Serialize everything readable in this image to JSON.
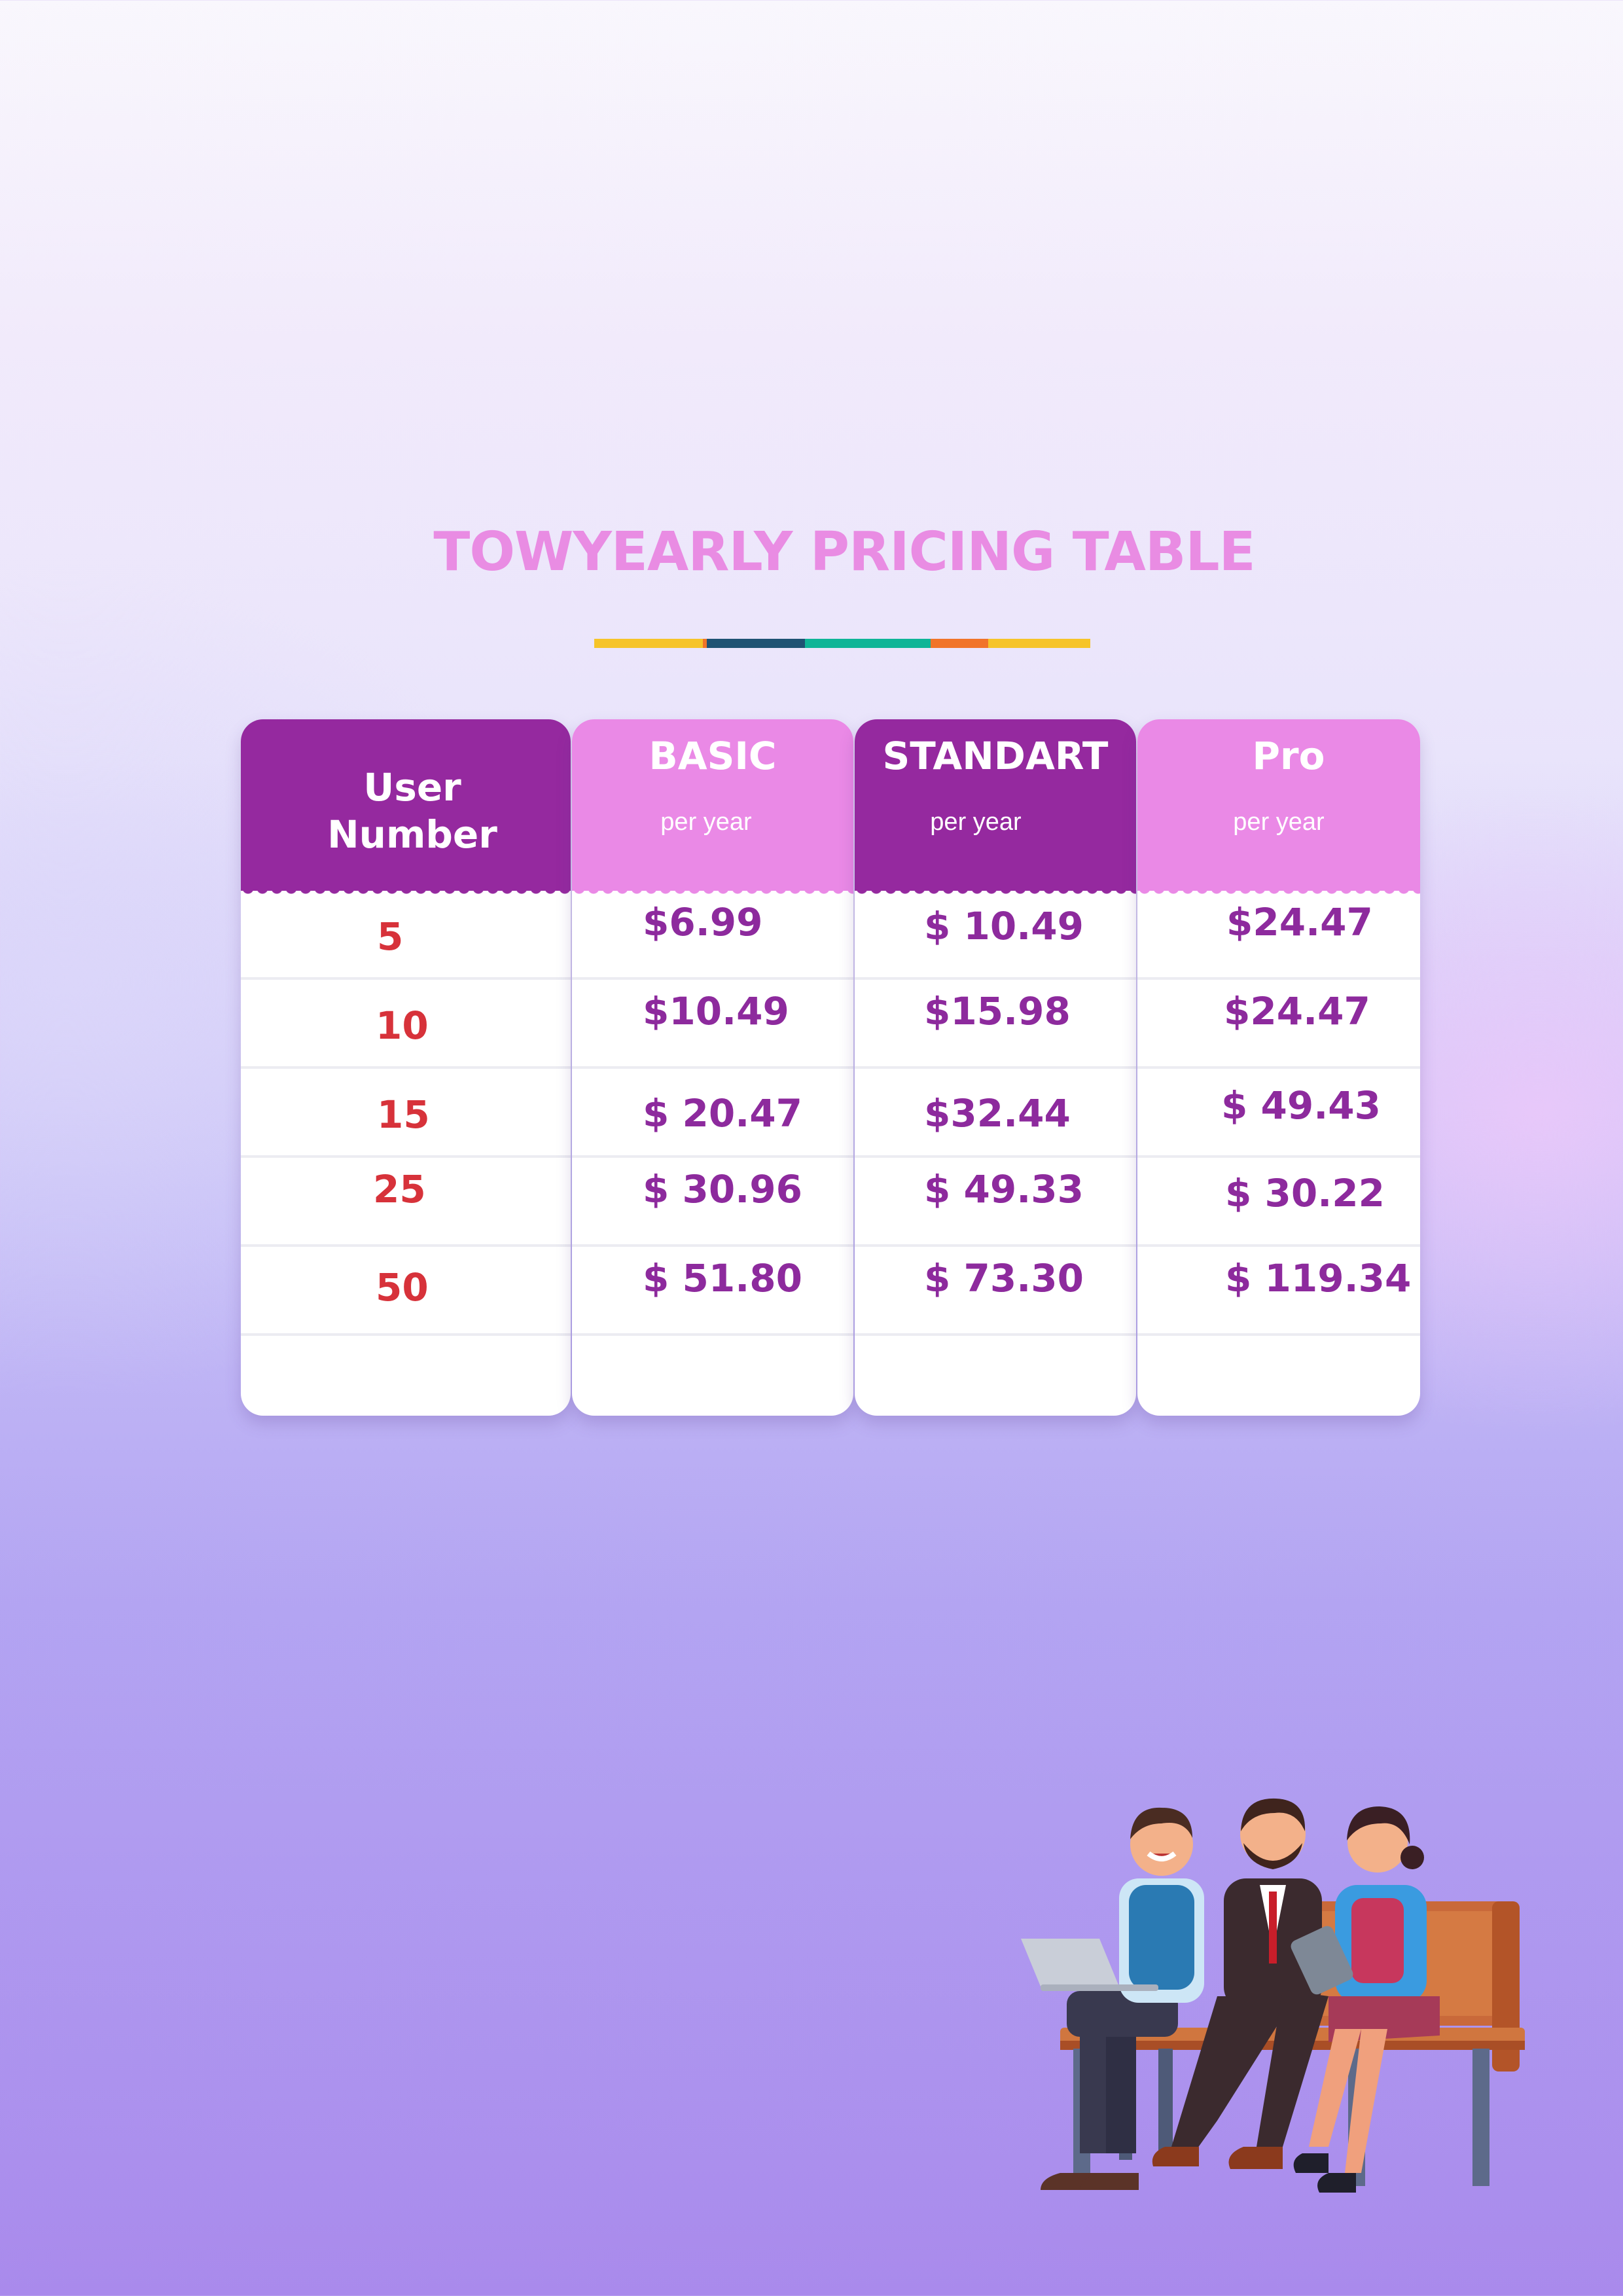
{
  "title": "TOWYEARLY PRICING TABLE",
  "divider_colors": [
    "#f6c429",
    "#1f5373",
    "#0fb597",
    "#f17429",
    "#f6c429"
  ],
  "colors": {
    "title": "#e98ce3",
    "header_dark": "#95299f",
    "header_light": "#ea89e6",
    "user_number_text": "#d7323a",
    "price_text": "#8d2a9d"
  },
  "table": {
    "user_header": "User\nNumber",
    "plans": [
      {
        "name": "BASIC",
        "period": "per year"
      },
      {
        "name": "STANDART",
        "period": "per year"
      },
      {
        "name": "Pro",
        "period": "per year"
      }
    ],
    "user_numbers": [
      "5",
      "10",
      "15",
      "25",
      "50"
    ],
    "prices": [
      [
        "$6.99",
        "$10.49",
        "$ 20.47",
        "$ 30.96",
        "$ 51.80"
      ],
      [
        "$ 10.49",
        "$15.98",
        "$32.44",
        "$ 49.33",
        "$ 73.30"
      ],
      [
        "$24.47",
        "$24.47",
        "$ 49.43",
        "$ 30.22",
        "$ 119.34"
      ]
    ]
  },
  "illustration": {
    "icon": "three-business-people-on-bench-icon"
  }
}
